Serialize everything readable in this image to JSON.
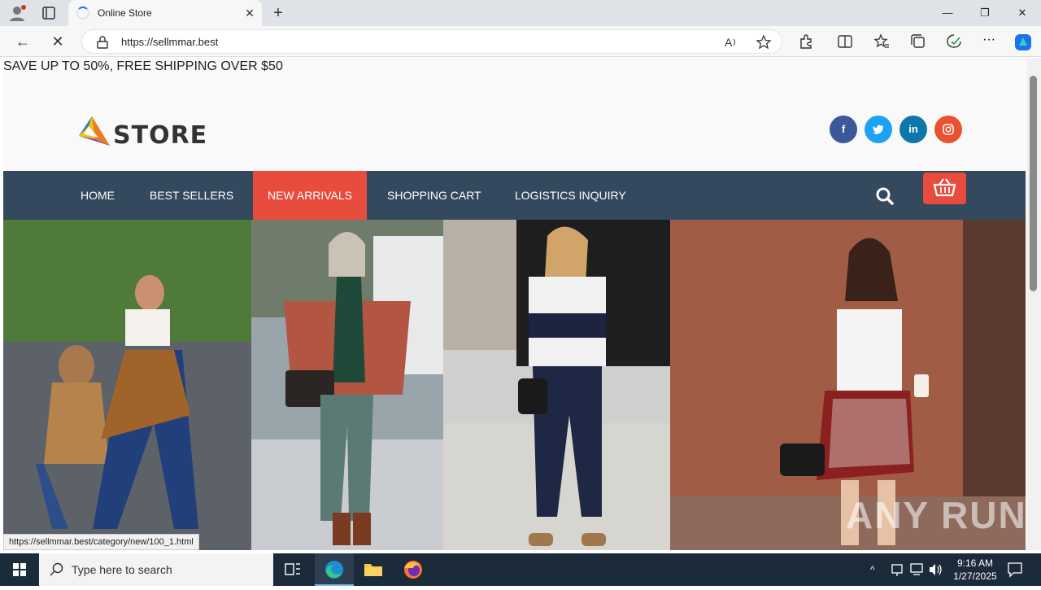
{
  "browser": {
    "tab_title": "Online Store",
    "url": "https://sellmmar.best",
    "status_url": "https://sellmmar.best/category/new/100_1.html"
  },
  "site": {
    "promo": "SAVE UP TO 50%, FREE SHIPPING OVER $50",
    "logo_text": "STORE",
    "social": [
      "facebook",
      "twitter",
      "linkedin",
      "instagram"
    ],
    "menu": [
      {
        "label": "HOME",
        "active": false
      },
      {
        "label": "BEST SELLERS",
        "active": false
      },
      {
        "label": "NEW ARRIVALS",
        "active": true
      },
      {
        "label": "SHOPPING CART",
        "active": false
      },
      {
        "label": "LOGISTICS INQUIRY",
        "active": false
      }
    ],
    "colors": {
      "menu_bg": "#34495e",
      "accent": "#e74c3c"
    }
  },
  "watermark": "ANY RUN",
  "taskbar": {
    "search_placeholder": "Type here to search",
    "time": "9:16 AM",
    "date": "1/27/2025"
  }
}
